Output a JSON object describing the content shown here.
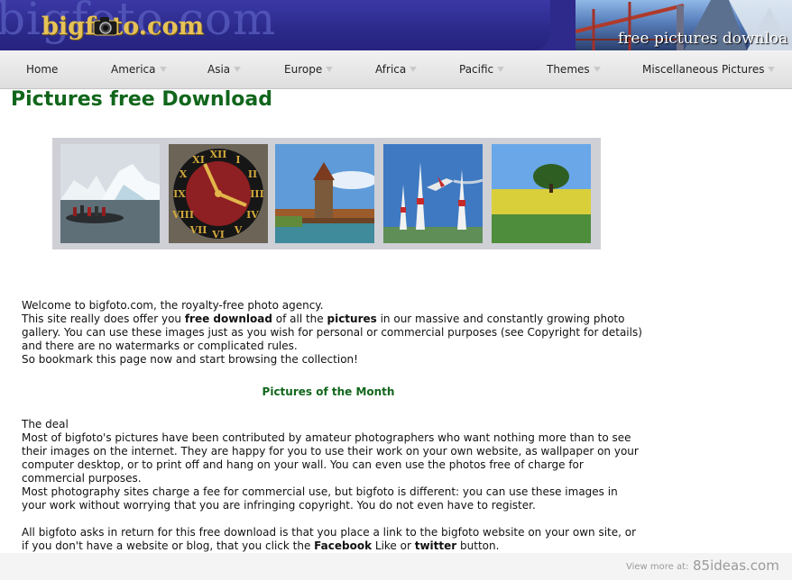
{
  "header": {
    "logo_text": "bigfoto.com",
    "tagline": "free pictures downloa"
  },
  "nav": {
    "items": [
      {
        "label": "Home",
        "dropdown": false
      },
      {
        "label": "America",
        "dropdown": true
      },
      {
        "label": "Asia",
        "dropdown": true
      },
      {
        "label": "Europe",
        "dropdown": true
      },
      {
        "label": "Africa",
        "dropdown": true
      },
      {
        "label": "Pacific",
        "dropdown": true
      },
      {
        "label": "Themes",
        "dropdown": true
      },
      {
        "label": "Miscellaneous Pictures",
        "dropdown": true
      }
    ]
  },
  "main": {
    "title": "Pictures free Download",
    "gallery": [
      {
        "subject": "icebergs with boat"
      },
      {
        "subject": "clock face"
      },
      {
        "subject": "chapel bridge tower"
      },
      {
        "subject": "air race pylons and plane"
      },
      {
        "subject": "tree on yellow field"
      }
    ],
    "intro": {
      "line1": "Welcome to bigfoto.com, the royalty-free photo agency.",
      "p2_a": "This site really does offer you ",
      "p2_b": "free download",
      "p2_c": " of all the ",
      "p2_d": "pictures",
      "p2_e": " in our massive and constantly growing photo gallery. You can use these images just as you wish for personal or commercial purposes (see Copyright for details) and there are no watermarks or complicated rules.",
      "line3": "So bookmark this page now and start browsing the collection!"
    },
    "month_title": "Pictures of the Month",
    "deal": {
      "heading": "The deal",
      "p1": "Most of bigfoto's pictures have been contributed by amateur photographers who want nothing more than to see their images on the internet. They are happy for you to use their work on your own website, as wallpaper on your computer desktop, or to print off and hang on your wall. You can even use the photos free of charge for commercial purposes.",
      "p2": "Most photography sites charge a fee for commercial use, but bigfoto is different: you can use these images in your work without worrying that you are infringing copyright. You do not even have to register.",
      "p3_a": "All bigfoto asks in return for this free download is that you place a link to the bigfoto website on your own site, or if you don't have a website or blog, that you click the ",
      "p3_b": "Facebook",
      "p3_c": " Like or ",
      "p3_d": "twitter",
      "p3_e": " button."
    }
  },
  "footer": {
    "small": "View more at:",
    "site": "85ideas.com"
  },
  "colors": {
    "header_blue": "#2e2a8c",
    "logo_gold": "#e6c257",
    "title_green": "#11661b",
    "gallery_frame": "#cfcfd6"
  }
}
